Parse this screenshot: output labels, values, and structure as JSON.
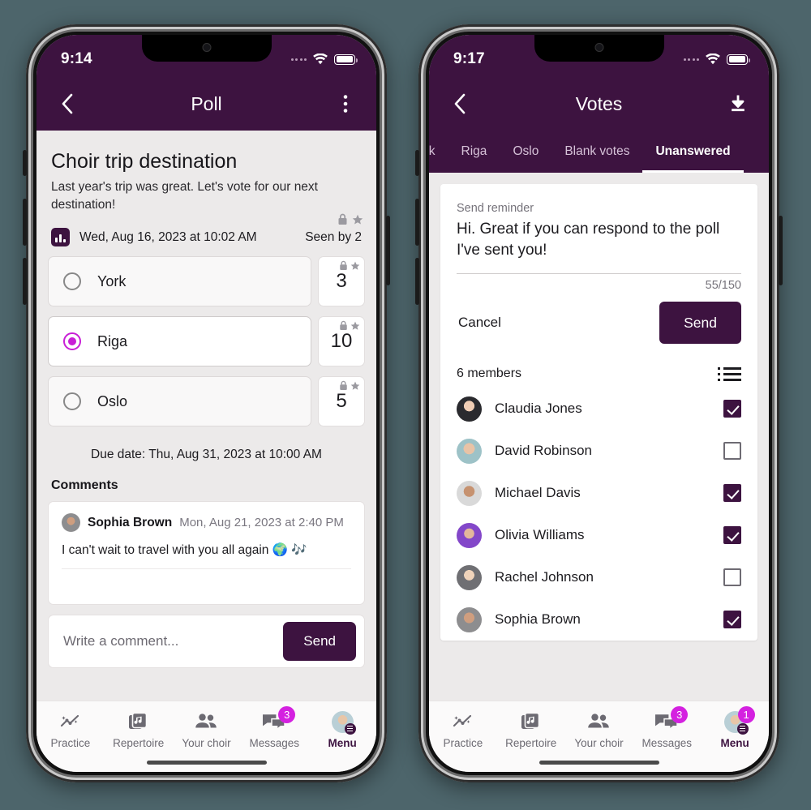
{
  "colors": {
    "page_background": "#4d656b",
    "brand_purple": "#3d1340",
    "accent_magenta": "#c81fd6",
    "badge_pink": "#d421e0",
    "screen_background": "#eceaea"
  },
  "left_phone": {
    "status_bar": {
      "time": "9:14"
    },
    "app_bar": {
      "back_icon": "chevron-left-icon",
      "title": "Poll",
      "overflow_icon": "more-vertical-icon"
    },
    "poll": {
      "title": "Choir trip destination",
      "description": "Last year's trip was great. Let's vote for our next destination!",
      "type_icon": "poll-bar-chart-icon",
      "date": "Wed, Aug 16, 2023 at 10:02 AM",
      "seen_by": "Seen by 2",
      "lock_icon": "lock-icon",
      "star_icon": "star-icon",
      "options": [
        {
          "label": "York",
          "count": "3",
          "selected": false
        },
        {
          "label": "Riga",
          "count": "10",
          "selected": true
        },
        {
          "label": "Oslo",
          "count": "5",
          "selected": false
        }
      ],
      "due_date": "Due date: Thu, Aug 31, 2023 at 10:00 AM"
    },
    "comments": {
      "heading": "Comments",
      "items": [
        {
          "author": "Sophia Brown",
          "timestamp": "Mon, Aug 21, 2023 at 2:40 PM",
          "text": "I can't wait to travel with you all again 🌍 🎶"
        }
      ],
      "composer": {
        "placeholder": "Write a comment...",
        "value": "",
        "send_label": "Send"
      }
    },
    "bottom_nav": {
      "items": [
        {
          "label": "Practice",
          "icon": "practice-chart-icon",
          "badge": "",
          "active": false
        },
        {
          "label": "Repertoire",
          "icon": "music-note-icon",
          "badge": "",
          "active": false
        },
        {
          "label": "Your choir",
          "icon": "people-icon",
          "badge": "",
          "active": false
        },
        {
          "label": "Messages",
          "icon": "chat-bubbles-icon",
          "badge": "3",
          "active": false
        },
        {
          "label": "Menu",
          "icon": "avatar-menu-icon",
          "badge": "",
          "active": true
        }
      ]
    }
  },
  "right_phone": {
    "status_bar": {
      "time": "9:17"
    },
    "app_bar": {
      "back_icon": "chevron-left-icon",
      "title": "Votes",
      "download_icon": "download-icon"
    },
    "tabs": [
      {
        "label": "ork",
        "active": false
      },
      {
        "label": "Riga",
        "active": false
      },
      {
        "label": "Oslo",
        "active": false
      },
      {
        "label": "Blank votes",
        "active": false
      },
      {
        "label": "Unanswered",
        "active": true
      }
    ],
    "reminder": {
      "field_label": "Send reminder",
      "message": "Hi. Great if you can respond to the poll I've sent you!",
      "char_counter": "55/150",
      "cancel_label": "Cancel",
      "send_label": "Send"
    },
    "members_header": {
      "count_label": "6 members",
      "list_icon": "list-view-icon"
    },
    "members": [
      {
        "name": "Claudia Jones",
        "checked": true
      },
      {
        "name": "David Robinson",
        "checked": false
      },
      {
        "name": "Michael Davis",
        "checked": true
      },
      {
        "name": "Olivia Williams",
        "checked": true
      },
      {
        "name": "Rachel Johnson",
        "checked": false
      },
      {
        "name": "Sophia Brown",
        "checked": true
      }
    ],
    "bottom_nav": {
      "items": [
        {
          "label": "Practice",
          "icon": "practice-chart-icon",
          "badge": "",
          "active": false
        },
        {
          "label": "Repertoire",
          "icon": "music-note-icon",
          "badge": "",
          "active": false
        },
        {
          "label": "Your choir",
          "icon": "people-icon",
          "badge": "",
          "active": false
        },
        {
          "label": "Messages",
          "icon": "chat-bubbles-icon",
          "badge": "3",
          "active": false
        },
        {
          "label": "Menu",
          "icon": "avatar-menu-icon",
          "badge": "1",
          "active": true
        }
      ]
    }
  }
}
